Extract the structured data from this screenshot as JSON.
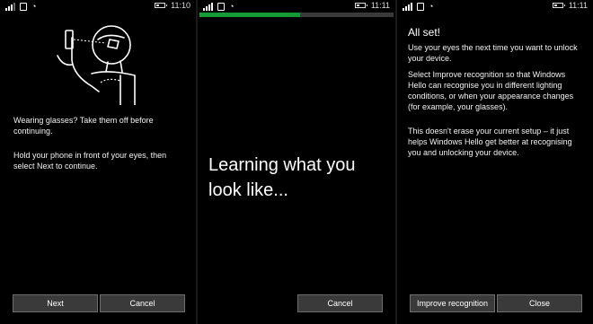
{
  "screens": {
    "setup": {
      "time": "11:10",
      "instructions": {
        "glasses": "Wearing glasses? Take them off before continuing.",
        "hold": "Hold your phone in front of your eyes, then select Next to continue."
      },
      "buttons": {
        "next": "Next",
        "cancel": "Cancel"
      }
    },
    "learning": {
      "time": "11:11",
      "progress_fraction": 0.52,
      "progress_color": "#139c36",
      "headline": "Learning what you look like...",
      "buttons": {
        "cancel": "Cancel"
      }
    },
    "done": {
      "time": "11:11",
      "title": "All set!",
      "p1": "Use your eyes the next time you want to unlock your device.",
      "p2": "Select Improve recognition so that Windows Hello can recognise you in different lighting conditions, or when your appearance changes (for example, your glasses).",
      "p3": "This doesn't erase your current setup – it just helps Windows Hello get better at recognising you and unlocking your device.",
      "buttons": {
        "improve": "Improve recognition",
        "close": "Close"
      }
    }
  },
  "icons": [
    "signal-icon",
    "phone-icon",
    "wifi-icon",
    "battery-icon"
  ]
}
